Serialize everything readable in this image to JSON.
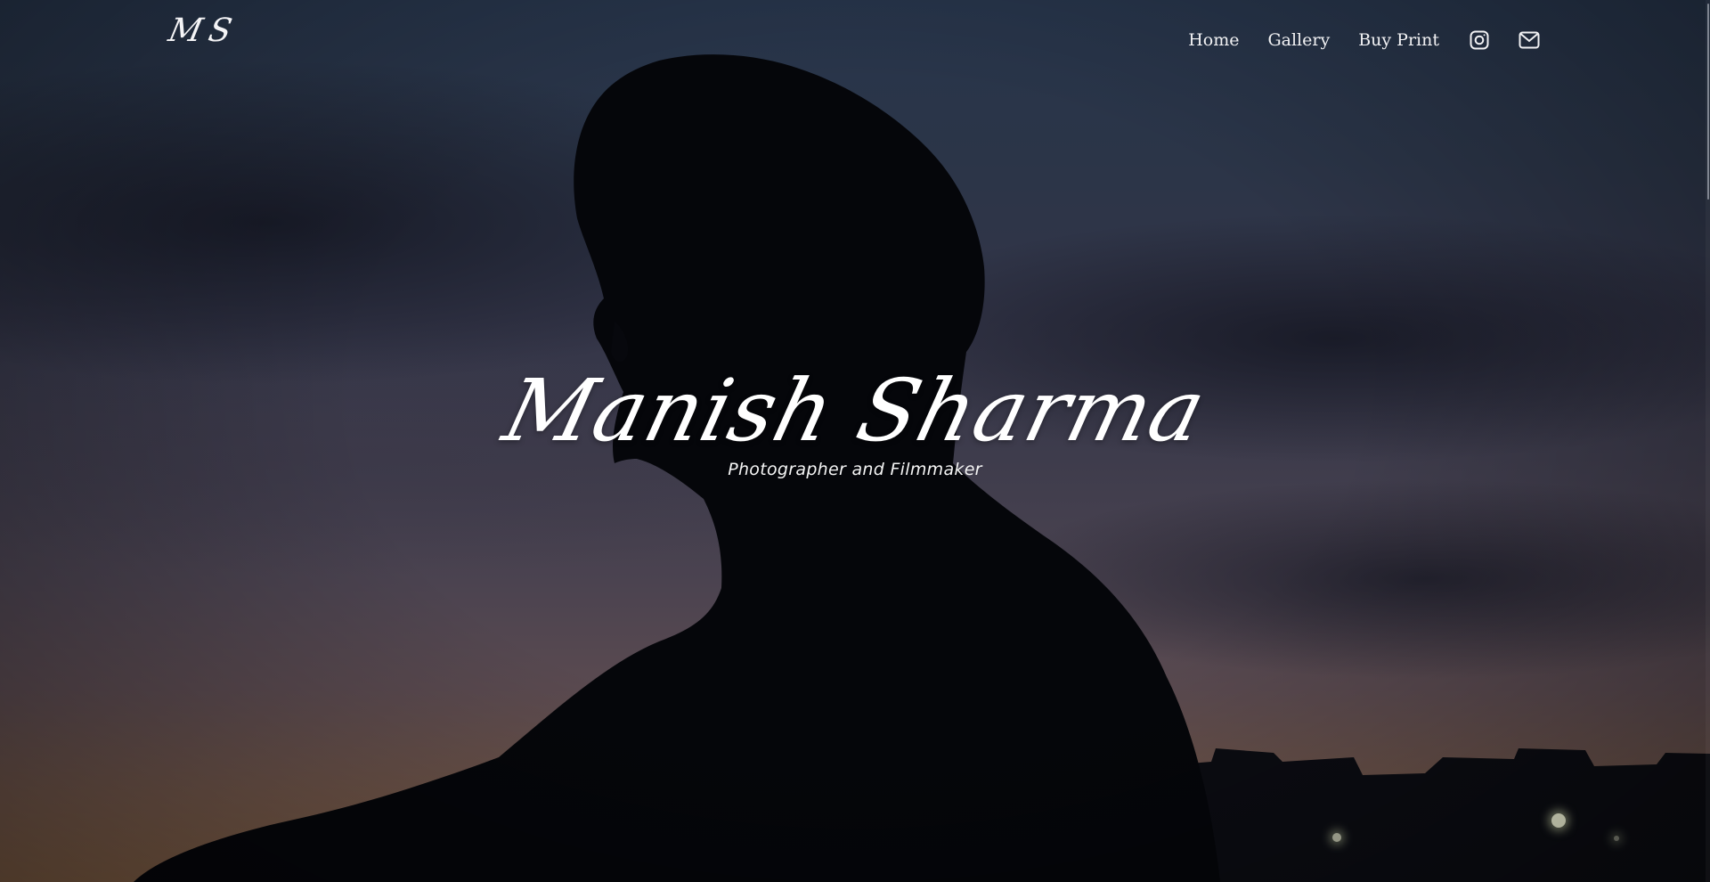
{
  "header": {
    "logo_text": "MS",
    "nav": {
      "home_label": "Home",
      "gallery_label": "Gallery",
      "buy_print_label": "Buy Print"
    },
    "icons": [
      "instagram-icon",
      "mail-icon"
    ]
  },
  "hero": {
    "title": "Manish Sharma",
    "subtitle": "Photographer and Filmmaker"
  },
  "colors": {
    "text": "#ffffff",
    "sky_top": "#27354b",
    "sky_horizon": "#7a5a42",
    "silhouette": "#05060a"
  }
}
